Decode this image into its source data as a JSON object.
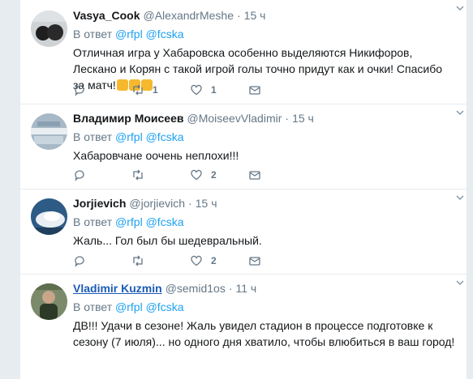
{
  "reply_to_label": "В ответ",
  "tweets": [
    {
      "name": "Vasya_Cook",
      "handle": "@AlexandrMeshe",
      "time": "15 ч",
      "mentions": [
        "@rfpl",
        "@fcska"
      ],
      "text": "Отличная игра у Хабаровска особенно выделяются Никифоров, Лескано и Корян с такой игрой голы точно придут как и очки! Спасибо за матч!",
      "emojis": [
        "thumbs-up-emoji",
        "clapping-hands-emoji",
        "flexed-biceps-emoji"
      ],
      "reply_count": "",
      "retweet_count": "1",
      "like_count": "1"
    },
    {
      "name": "Владимир Моисеев",
      "handle": "@MoiseevVladimir",
      "time": "15 ч",
      "mentions": [
        "@rfpl",
        "@fcska"
      ],
      "text": "Хабаровчане оочень неплохи!!!",
      "reply_count": "",
      "retweet_count": "",
      "like_count": "2"
    },
    {
      "name": "Jorjievich",
      "handle": "@jorjievich",
      "time": "15 ч",
      "mentions": [
        "@rfpl",
        "@fcska"
      ],
      "text": "Жаль... Гол был бы шедевральный.",
      "reply_count": "",
      "retweet_count": "",
      "like_count": "2"
    },
    {
      "name": "Vladimir Kuzmin",
      "handle": "@semid1os",
      "time": "11 ч",
      "mentions": [
        "@rfpl",
        "@fcska"
      ],
      "text": "ДВ!!! Удачи в сезоне! Жаль увидел стадион в процессе подготовке к сезону (7 июля)... но одного дня хватило, чтобы влюбиться в ваш город!",
      "reply_count": "",
      "retweet_count": "",
      "like_count": ""
    }
  ],
  "colors": {
    "accent": "#1da1f2",
    "text": "#14171a",
    "secondary": "#657786",
    "border": "#e6ecf0",
    "linked_name": "#1b5bb5"
  }
}
